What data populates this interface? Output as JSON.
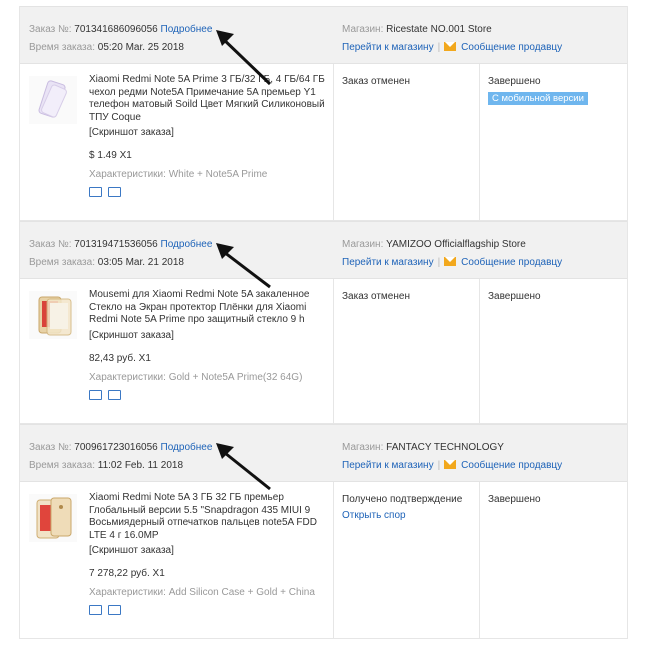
{
  "labels": {
    "order_no": "Заказ №:",
    "order_time": "Время заказа:",
    "details": "Подробнее",
    "store": "Магазин:",
    "go_to_store": "Перейти к магазину",
    "message_seller": "Сообщение продавцу",
    "screenshot": "[Скриншот заказа]",
    "specs_prefix": "Характеристики:"
  },
  "colors": {
    "link": "#1e63b8",
    "mobile_badge": "#6fb6ee",
    "mail_icon": "#f2a81d"
  },
  "orders": [
    {
      "number": "701341686096056",
      "time": "05:20 Mar. 25 2018",
      "store": "Ricestate NO.001 Store",
      "product": "Xiaomi Redmi Note 5A Prime 3 ГБ/32 ГБ, 4 ГБ/64 ГБ чехол редми Note5A Примечание 5A премьер Y1 телефон матовый Soild Цвет Мягкий Силиконовый ТПУ Coque",
      "price": "$ 1.49 X1",
      "specs": "White + Note5A Prime",
      "status": "Заказ отменен",
      "status_link": "",
      "state": "Завершено",
      "mobile_badge": "С мобильной версии"
    },
    {
      "number": "701319471536056",
      "time": "03:05 Mar. 21 2018",
      "store": "YAMIZOO Officialflagship Store",
      "product": "Mousemi для Xiaomi Redmi Note 5A закаленное Стекло на Экран протектор Плёнки для Xiaomi Redmi Note 5A Prime про защитный стекло 9 h",
      "price": "82,43 руб. X1",
      "specs": "Gold + Note5A Prime(32 64G)",
      "status": "Заказ отменен",
      "status_link": "",
      "state": "Завершено",
      "mobile_badge": ""
    },
    {
      "number": "700961723016056",
      "time": "11:02 Feb. 11 2018",
      "store": "FANTACY TECHNOLOGY",
      "product": "Xiaomi Redmi Note 5A 3 ГБ 32 ГБ премьер Глобальный версии 5.5 \"Snapdragon 435 MIUI 9 Восьмиядерный отпечатков пальцев note5A FDD LTE 4 г 16.0MP",
      "price": "7 278,22 руб. X1",
      "specs": "Add Silicon Case + Gold + China",
      "status": "Получено подтверждение",
      "status_link": "Открыть спор",
      "state": "Завершено",
      "mobile_badge": ""
    }
  ]
}
